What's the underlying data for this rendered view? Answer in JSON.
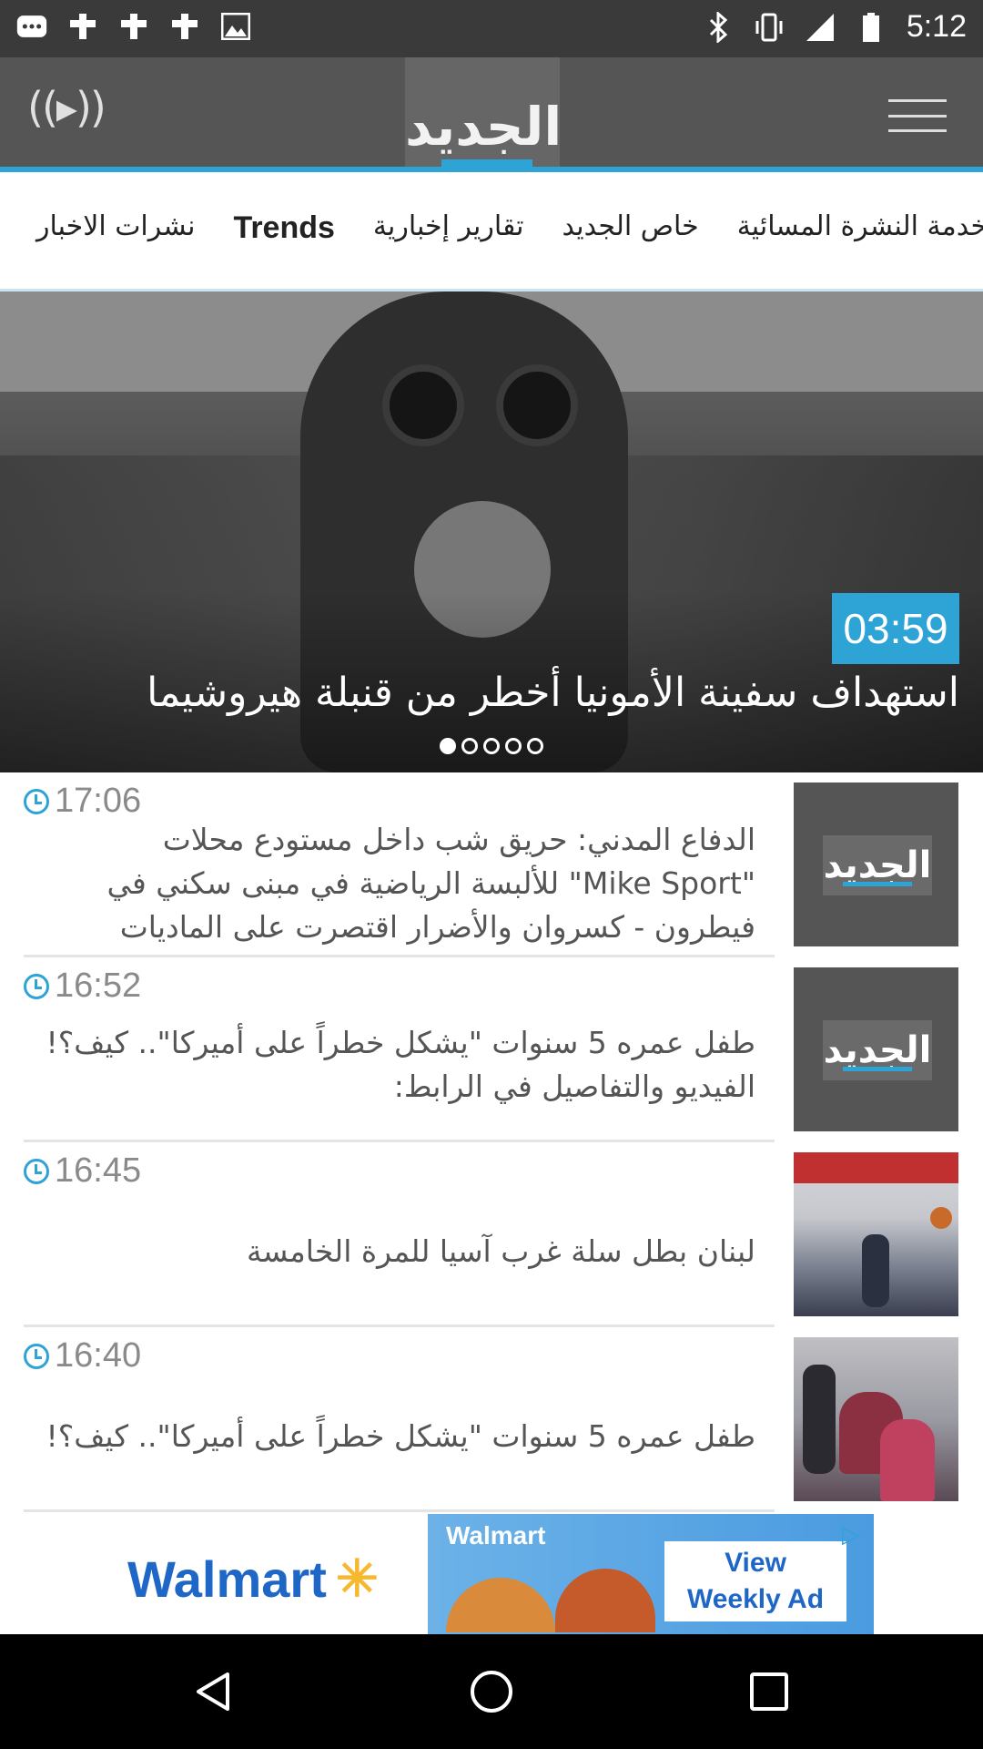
{
  "status_bar": {
    "time": "5:12",
    "icons": [
      "messages-icon",
      "notification-icon",
      "notification-icon",
      "notification-icon",
      "image-icon",
      "bluetooth-icon",
      "vibrate-icon",
      "signal-icon",
      "battery-icon"
    ]
  },
  "app_bar": {
    "logo_text": "الجديد",
    "live_icon": "live-radio-icon",
    "menu_icon": "hamburger-menu-icon"
  },
  "tabs": [
    {
      "label": "خدمة النشرة المسائية",
      "active": false
    },
    {
      "label": "خاص الجديد",
      "active": false
    },
    {
      "label": "تقارير إخبارية",
      "active": false
    },
    {
      "label": "Trends",
      "active": true
    },
    {
      "label": "نشرات الاخبار",
      "active": false
    }
  ],
  "hero": {
    "duration": "03:59",
    "headline": "استهداف سفينة الأمونيا أخطر من قنبلة هيروشيما",
    "slide_count": 5,
    "active_slide": 1
  },
  "news": [
    {
      "time": "17:06",
      "title_lines": [
        "الدفاع المدني: حريق شب داخل مستودع محلات",
        "\"Mike Sport\" للألبسة الرياضية في مبنى سكني في",
        "فيطرون - كسروان والأضرار اقتصرت على الماديات"
      ],
      "thumb": "logo"
    },
    {
      "time": "16:52",
      "title_lines": [
        "طفل عمره 5 سنوات \"يشكل خطراً على أميركا\".. كيف؟!",
        "الفيديو والتفاصيل في الرابط:"
      ],
      "thumb": "logo"
    },
    {
      "time": "16:45",
      "title_lines": [
        "لبنان بطل سلة غرب آسيا للمرة الخامسة"
      ],
      "thumb": "basketball-photo"
    },
    {
      "time": "16:40",
      "title_lines": [
        "طفل عمره 5 سنوات \"يشكل خطراً على أميركا\".. كيف؟!"
      ],
      "thumb": "people-photo"
    }
  ],
  "ad": {
    "brand": "Walmart",
    "photo_brand": "Walmart",
    "cta_line1": "View",
    "cta_line2": "Weekly Ad"
  },
  "colors": {
    "accent": "#2ea3d6",
    "appbar": "#555555",
    "status_bar": "#3a3a3a",
    "walmart_blue": "#1f67c7",
    "walmart_yellow": "#f5b82e"
  }
}
